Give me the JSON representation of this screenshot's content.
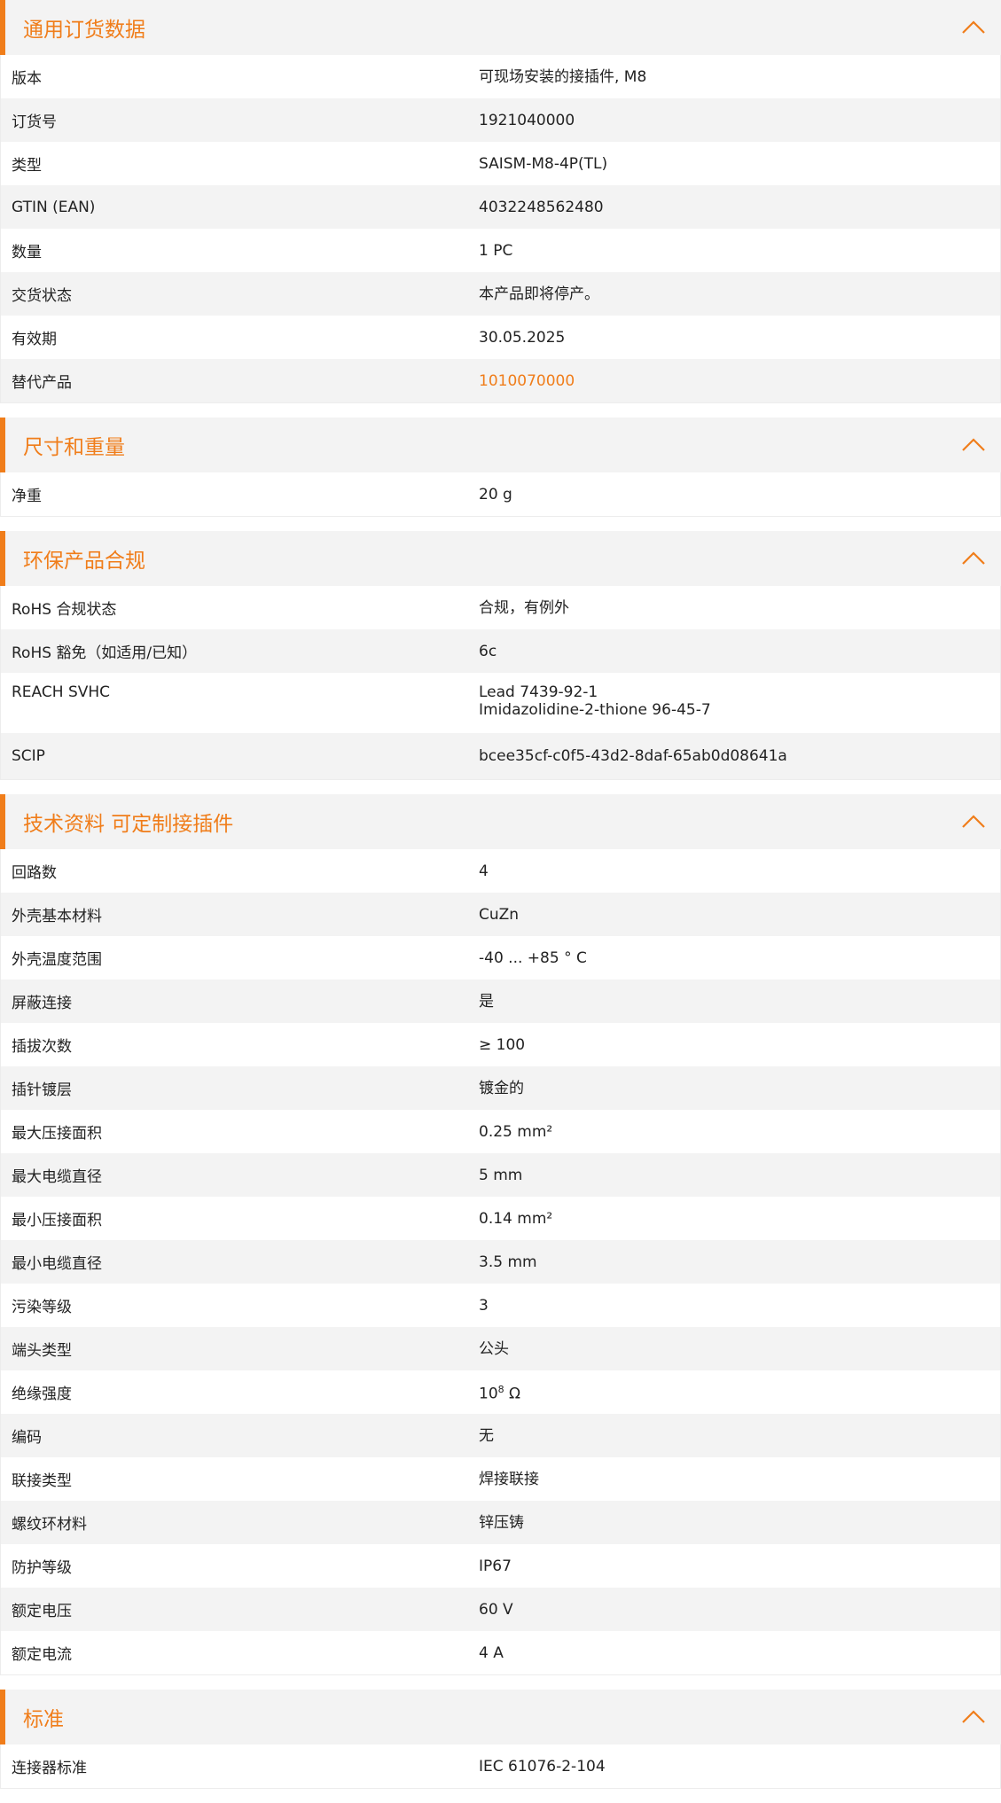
{
  "colors": {
    "accent": "#f07d1a",
    "header_bg": "#f3f3f3",
    "row_alt_bg": "#f3f3f3",
    "row_bg": "#ffffff"
  },
  "icons": {
    "collapse": "chevron-up-icon"
  },
  "sections": [
    {
      "title": "通用订货数据",
      "rows": [
        {
          "label": "版本",
          "value": "可现场安装的接插件, M8"
        },
        {
          "label": "订货号",
          "value": "1921040000"
        },
        {
          "label": "类型",
          "value": "SAISM-M8-4P(TL)"
        },
        {
          "label": "GTIN (EAN)",
          "value": "4032248562480"
        },
        {
          "label": "数量",
          "value": "1  PC"
        },
        {
          "label": "交货状态",
          "value": "本产品即将停产。"
        },
        {
          "label": "有效期",
          "value": "30.05.2025"
        },
        {
          "label": "替代产品",
          "value": "1010070000"
        }
      ]
    },
    {
      "title": "尺寸和重量",
      "rows": [
        {
          "label": "净重",
          "value": "20  g"
        }
      ]
    },
    {
      "title": "环保产品合规",
      "rows": [
        {
          "label": "RoHS 合规状态",
          "value": "合规，有例外"
        },
        {
          "label": "RoHS 豁免（如适用/已知）",
          "value": "6c"
        },
        {
          "label": "REACH SVHC",
          "value": "Lead 7439-92-1",
          "value2": "Imidazolidine-2-thione 96-45-7"
        },
        {
          "label": "SCIP",
          "value": "bcee35cf-c0f5-43d2-8daf-65ab0d08641a"
        }
      ]
    },
    {
      "title": "技术资料 可定制接插件",
      "rows": [
        {
          "label": "回路数",
          "value": "4"
        },
        {
          "label": "外壳基本材料",
          "value": "CuZn"
        },
        {
          "label": "外壳温度范围",
          "value": "-40 ... +85 ° C"
        },
        {
          "label": "屏蔽连接",
          "value": "是"
        },
        {
          "label": "插拔次数",
          "value": "≥ 100"
        },
        {
          "label": "插针镀层",
          "value": "镀金的"
        },
        {
          "label": "最大压接面积",
          "value": "0.25  mm²"
        },
        {
          "label": "最大电缆直径",
          "value": "5  mm"
        },
        {
          "label": "最小压接面积",
          "value": "0.14  mm²"
        },
        {
          "label": "最小电缆直径",
          "value": "3.5  mm"
        },
        {
          "label": "污染等级",
          "value": "3"
        },
        {
          "label": "端头类型",
          "value": "公头"
        },
        {
          "label": "绝缘强度",
          "value_base": "10",
          "value_sup": "8",
          "value_unit": " Ω"
        },
        {
          "label": "编码",
          "value": "无"
        },
        {
          "label": "联接类型",
          "value": "焊接联接"
        },
        {
          "label": "螺纹环材料",
          "value": "锌压铸"
        },
        {
          "label": "防护等级",
          "value": "IP67"
        },
        {
          "label": "额定电压",
          "value": "60  V"
        },
        {
          "label": "额定电流",
          "value": "4  A"
        }
      ]
    },
    {
      "title": "标准",
      "rows": [
        {
          "label": "连接器标准",
          "value": "IEC 61076-2-104"
        }
      ]
    }
  ]
}
